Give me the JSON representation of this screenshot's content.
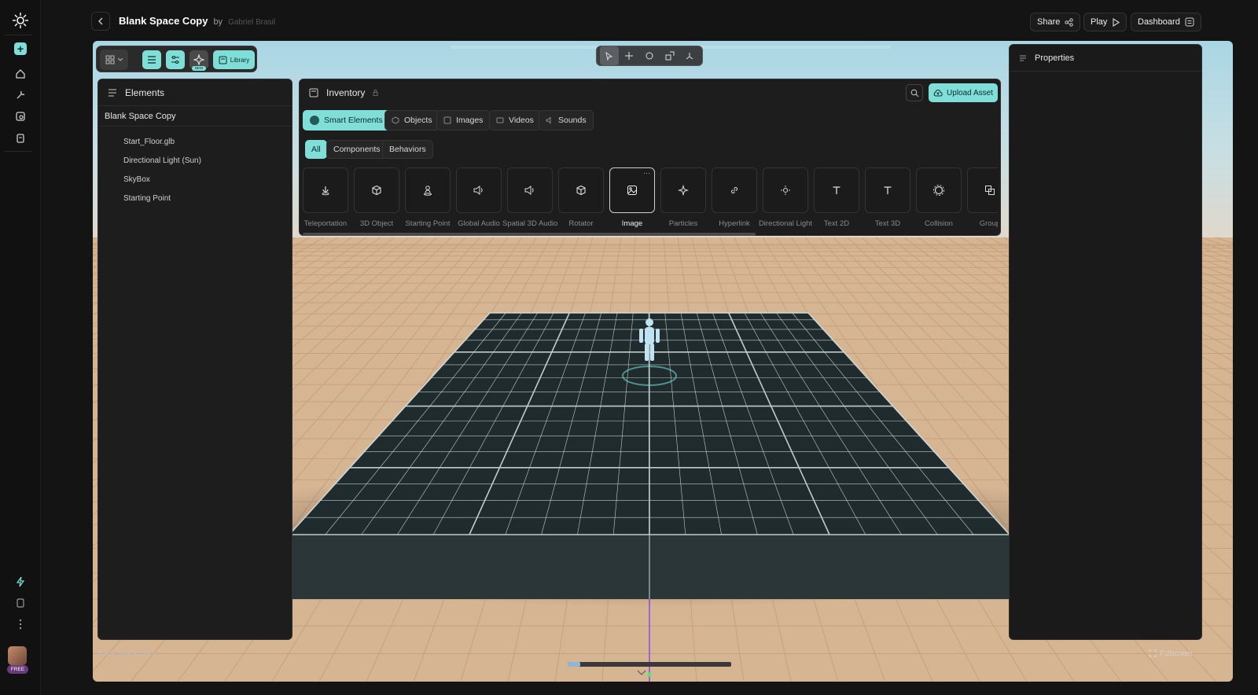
{
  "header": {
    "title": "Blank Space Copy",
    "by_label": "by",
    "author": "Gabriel Brasil",
    "share_label": "Share",
    "play_label": "Play",
    "dashboard_label": "Dashboard"
  },
  "rail": {
    "plan_badge": "FREE"
  },
  "toolbar": {
    "new_badge": "NEW",
    "library_label": "Library"
  },
  "elements_panel": {
    "title": "Elements",
    "root": "Blank Space Copy",
    "items": [
      "Start_Floor.glb",
      "Directional Light (Sun)",
      "SkyBox",
      "Starting Point"
    ]
  },
  "inventory": {
    "title": "Inventory",
    "upload_label": "Upload Asset",
    "tabs": [
      "Smart Elements",
      "Objects",
      "Images",
      "Videos",
      "Sounds"
    ],
    "filters": [
      "All",
      "Components",
      "Behaviors"
    ],
    "tiles": [
      {
        "label": "Teleportation",
        "icon": "teleport-icon"
      },
      {
        "label": "3D Object",
        "icon": "cube-icon"
      },
      {
        "label": "Starting Point",
        "icon": "person-pin-icon"
      },
      {
        "label": "Global Audio",
        "icon": "speaker-icon"
      },
      {
        "label": "Spatial 3D Audio",
        "icon": "speaker-icon"
      },
      {
        "label": "Rotator",
        "icon": "cube-icon"
      },
      {
        "label": "Image",
        "icon": "image-icon"
      },
      {
        "label": "Particles",
        "icon": "sparkle-icon"
      },
      {
        "label": "Hyperlink",
        "icon": "link-icon"
      },
      {
        "label": "Directional Light",
        "icon": "sun-icon"
      },
      {
        "label": "Text 2D",
        "icon": "text-icon"
      },
      {
        "label": "Text 3D",
        "icon": "text-icon"
      },
      {
        "label": "Collision",
        "icon": "gear-icon"
      },
      {
        "label": "Group",
        "icon": "group-icon"
      }
    ]
  },
  "properties": {
    "title": "Properties"
  },
  "footer": {
    "scene_name": "Blank Space Copy",
    "fullscreen_label": "Fullscreen"
  },
  "colors": {
    "accent": "#7fdfd8",
    "background": "#141414",
    "panel": "#1d1d1d",
    "floor": "#1f2b2d",
    "sand": "#d9b896"
  }
}
